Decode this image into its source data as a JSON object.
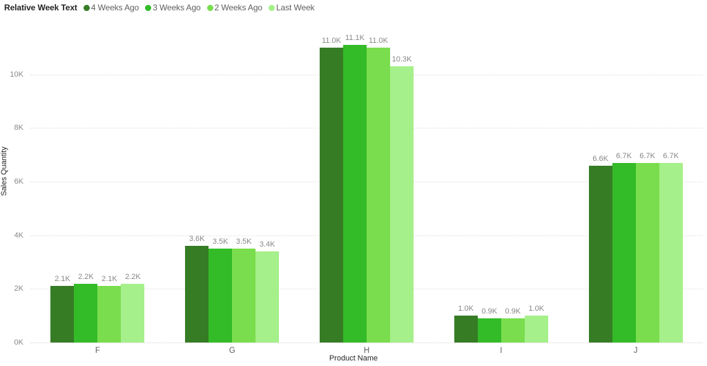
{
  "legend": {
    "title": "Relative Week Text",
    "items": [
      {
        "label": "4 Weeks Ago",
        "color": "#367C25"
      },
      {
        "label": "3 Weeks Ago",
        "color": "#33BB28"
      },
      {
        "label": "2 Weeks Ago",
        "color": "#7ADD4D"
      },
      {
        "label": "Last Week",
        "color": "#A5F08A"
      }
    ]
  },
  "axes": {
    "y_title": "Sales Quantity",
    "x_title": "Product Name",
    "y_ticks": [
      "0K",
      "2K",
      "4K",
      "6K",
      "8K",
      "10K"
    ]
  },
  "chart_data": {
    "type": "bar",
    "title": "",
    "subtitle": "",
    "xlabel": "Product Name",
    "ylabel": "Sales Quantity",
    "categories": [
      "F",
      "G",
      "H",
      "I",
      "J"
    ],
    "ylim": [
      0,
      11600
    ],
    "ytick_values": [
      0,
      2000,
      4000,
      6000,
      8000,
      10000
    ],
    "ytick_labels": [
      "0K",
      "2K",
      "4K",
      "6K",
      "8K",
      "10K"
    ],
    "grid": true,
    "grid_axis": "y",
    "legend_position": "top-left",
    "legend_title": "Relative Week Text",
    "series": [
      {
        "name": "4 Weeks Ago",
        "color": "#367C25",
        "values": [
          2100,
          3600,
          11000,
          1000,
          6600
        ],
        "labels": [
          "2.1K",
          "3.6K",
          "11.0K",
          "1.0K",
          "6.6K"
        ]
      },
      {
        "name": "3 Weeks Ago",
        "color": "#33BB28",
        "values": [
          2200,
          3500,
          11100,
          900,
          6700
        ],
        "labels": [
          "2.2K",
          "3.5K",
          "11.1K",
          "0.9K",
          "6.7K"
        ]
      },
      {
        "name": "2 Weeks Ago",
        "color": "#7ADD4D",
        "values": [
          2100,
          3500,
          11000,
          900,
          6700
        ],
        "labels": [
          "2.1K",
          "3.5K",
          "11.0K",
          "0.9K",
          "6.7K"
        ]
      },
      {
        "name": "Last Week",
        "color": "#A5F08A",
        "values": [
          2200,
          3400,
          10300,
          1000,
          6700
        ],
        "labels": [
          "2.2K",
          "3.4K",
          "10.3K",
          "1.0K",
          "6.7K"
        ]
      }
    ]
  }
}
